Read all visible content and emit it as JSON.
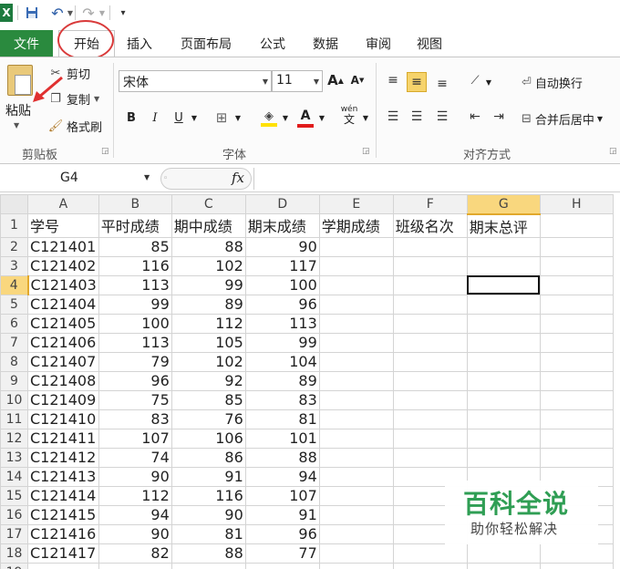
{
  "qat": {
    "logo": "X",
    "save_icon": "save-icon",
    "undo_icon": "undo-icon",
    "redo_icon": "redo-icon"
  },
  "tabs": [
    {
      "label": "文件"
    },
    {
      "label": "开始"
    },
    {
      "label": "插入"
    },
    {
      "label": "页面布局"
    },
    {
      "label": "公式"
    },
    {
      "label": "数据"
    },
    {
      "label": "审阅"
    },
    {
      "label": "视图"
    }
  ],
  "ribbon": {
    "clipboard": {
      "paste_label": "粘贴",
      "cut_label": "剪切",
      "copy_label": "复制",
      "format_painter_label": "格式刷",
      "group_label": "剪贴板"
    },
    "font": {
      "font_name": "宋体",
      "font_size": "11",
      "bold": "B",
      "italic": "I",
      "underline": "U",
      "grow": "A",
      "shrink": "A",
      "font_color_glyph": "A",
      "phonetic": "wén",
      "group_label": "字体"
    },
    "alignment": {
      "wrap_text": "自动换行",
      "merge_center": "合并后居中",
      "group_label": "对齐方式"
    }
  },
  "formula_bar": {
    "name_box": "G4",
    "fx": "fx",
    "formula": ""
  },
  "sheet": {
    "columns": [
      "A",
      "B",
      "C",
      "D",
      "E",
      "F",
      "G",
      "H"
    ],
    "selected_column": "G",
    "selected_row": 4,
    "header_row": [
      "学号",
      "平时成绩",
      "期中成绩",
      "期末成绩",
      "学期成绩",
      "班级名次",
      "期末总评",
      ""
    ],
    "rows": [
      [
        "C121401",
        "85",
        "88",
        "90"
      ],
      [
        "C121402",
        "116",
        "102",
        "117"
      ],
      [
        "C121403",
        "113",
        "99",
        "100"
      ],
      [
        "C121404",
        "99",
        "89",
        "96"
      ],
      [
        "C121405",
        "100",
        "112",
        "113"
      ],
      [
        "C121406",
        "113",
        "105",
        "99"
      ],
      [
        "C121407",
        "79",
        "102",
        "104"
      ],
      [
        "C121408",
        "96",
        "92",
        "89"
      ],
      [
        "C121409",
        "75",
        "85",
        "83"
      ],
      [
        "C121410",
        "83",
        "76",
        "81"
      ],
      [
        "C121411",
        "107",
        "106",
        "101"
      ],
      [
        "C121412",
        "74",
        "86",
        "88"
      ],
      [
        "C121413",
        "90",
        "91",
        "94"
      ],
      [
        "C121414",
        "112",
        "116",
        "107"
      ],
      [
        "C121415",
        "94",
        "90",
        "91"
      ],
      [
        "C121416",
        "90",
        "81",
        "96"
      ],
      [
        "C121417",
        "82",
        "88",
        "77"
      ]
    ]
  },
  "watermark": {
    "title": "百科全说",
    "subtitle": "助你轻松解决"
  },
  "colors": {
    "file_tab": "#2a8a3e",
    "highlight": "#d93b3b",
    "selected_header": "#f9d77e",
    "watermark": "#2f9e54"
  }
}
